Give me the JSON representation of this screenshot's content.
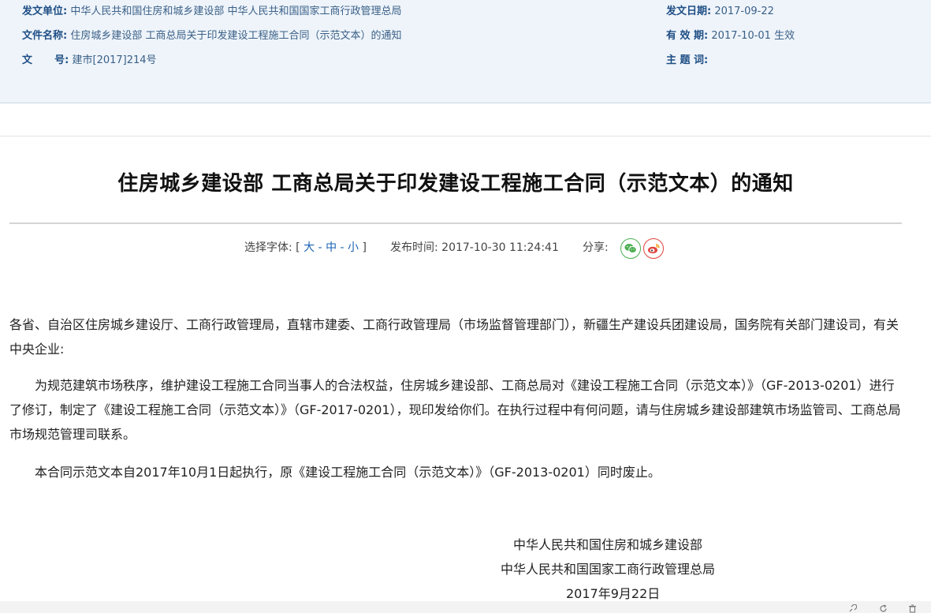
{
  "meta": {
    "issuer_label": "发文单位:",
    "issuer_value": "中华人民共和国住房和城乡建设部 中华人民共和国国家工商行政管理总局",
    "docname_label": "文件名称:",
    "docname_value": "住房城乡建设部 工商总局关于印发建设工程施工合同（示范文本）的通知",
    "docno_label_a": "文",
    "docno_label_b": "号:",
    "docno_value": "建市[2017]214号",
    "date_label": "发文日期:",
    "date_value": "2017-09-22",
    "validity_label": "有 效 期:",
    "validity_value": "2017-10-01 生效",
    "keywords_label": "主 题 词:"
  },
  "article": {
    "title": "住房城乡建设部 工商总局关于印发建设工程施工合同（示范文本）的通知",
    "font_label": "选择字体:",
    "font_bracket_open": "[",
    "font_large": "大",
    "font_medium": "中",
    "font_small": "小",
    "font_sep": "-",
    "font_bracket_close": "]",
    "publish_label": "发布时间:",
    "publish_time": "2017-10-30 11:24:41",
    "share_label": "分享:",
    "paragraph1": "各省、自治区住房城乡建设厅、工商行政管理局，直辖市建委、工商行政管理局（市场监督管理部门），新疆生产建设兵团建设局，国务院有关部门建设司，有关中央企业:",
    "paragraph2": "为规范建筑市场秩序，维护建设工程施工合同当事人的合法权益，住房城乡建设部、工商总局对《建设工程施工合同（示范文本）》（GF-2013-0201）进行了修订，制定了《建设工程施工合同（示范文本）》（GF-2017-0201），现印发给你们。在执行过程中有何问题，请与住房城乡建设部建筑市场监管司、工商总局市场规范管理司联系。",
    "paragraph3": "本合同示范文本自2017年10月1日起执行，原《建设工程施工合同（示范文本）》（GF-2013-0201）同时废止。",
    "signature1": "中华人民共和国住房和城乡建设部",
    "signature2": "中华人民共和国国家工商行政管理总局",
    "signature_date": "2017年9月22日"
  },
  "icons": {
    "share_wechat": "wechat-icon",
    "share_weibo": "weibo-icon"
  },
  "colors": {
    "meta_background": "#eef4fa",
    "meta_label": "#1f4e85",
    "link": "#1a63b3",
    "wechat": "#4caf50",
    "weibo": "#e0443e"
  }
}
